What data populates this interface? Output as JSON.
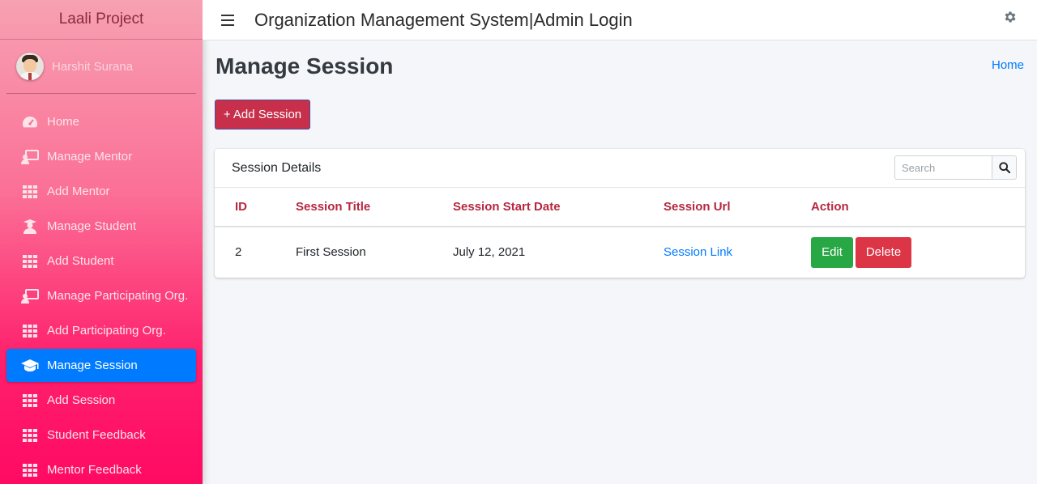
{
  "sidebar": {
    "brand": "Laali Project",
    "user_name": "Harshit Surana",
    "items": [
      {
        "label": "Home",
        "icon": "dashboard-icon"
      },
      {
        "label": "Manage Mentor",
        "icon": "chalkboard-teacher-icon"
      },
      {
        "label": "Add Mentor",
        "icon": "grid-icon"
      },
      {
        "label": "Manage Student",
        "icon": "user-graduate-icon"
      },
      {
        "label": "Add Student",
        "icon": "grid-icon"
      },
      {
        "label": "Manage Participating Org.",
        "icon": "chalkboard-teacher-icon"
      },
      {
        "label": "Add Participating Org.",
        "icon": "grid-icon"
      },
      {
        "label": "Manage Session",
        "icon": "graduation-cap-icon",
        "active": true
      },
      {
        "label": "Add Session",
        "icon": "grid-icon"
      },
      {
        "label": "Student Feedback",
        "icon": "grid-icon"
      },
      {
        "label": "Mentor Feedback",
        "icon": "grid-icon"
      }
    ]
  },
  "topbar": {
    "title": "Organization Management System|Admin Login"
  },
  "main": {
    "page_title": "Manage Session",
    "breadcrumb": "Home",
    "add_button": "+ Add Session",
    "card": {
      "title": "Session Details",
      "search_placeholder": "Search",
      "columns": [
        "ID",
        "Session Title",
        "Session Start Date",
        "Session Url",
        "Action"
      ],
      "rows": [
        {
          "id": "2",
          "title": "First Session",
          "start_date": "July 12, 2021",
          "url_label": "Session Link",
          "edit": "Edit",
          "delete": "Delete"
        }
      ]
    }
  },
  "colors": {
    "accent": "#007bff",
    "header_text": "#b5283f",
    "add_button": "#c82f4a",
    "edit": "#28a745",
    "delete": "#dc3545"
  }
}
